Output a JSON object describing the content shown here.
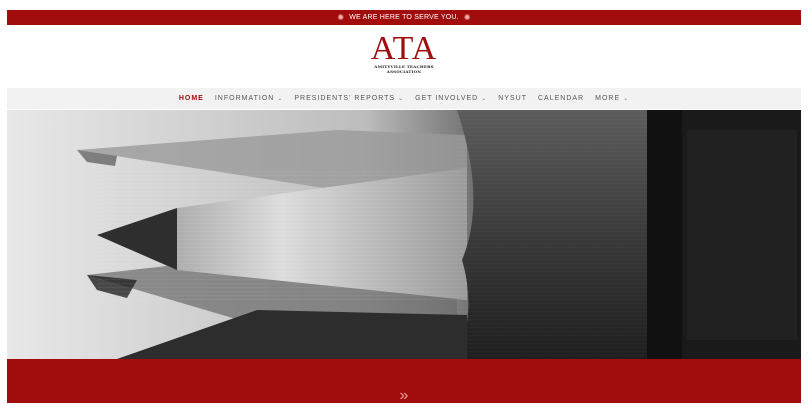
{
  "announcement": {
    "text": "WE ARE HERE TO SERVE YOU.",
    "icon": "star-icon"
  },
  "logo": {
    "mark": "ATA",
    "line1": "AMITYVILLE TEACHERS",
    "line2": "ASSOCIATION"
  },
  "nav": {
    "items": [
      {
        "label": "HOME",
        "active": true,
        "dropdown": false
      },
      {
        "label": "INFORMATION",
        "dropdown": true
      },
      {
        "label": "PRESIDENTS' REPORTS",
        "dropdown": true
      },
      {
        "label": "GET INVOLVED",
        "dropdown": true
      },
      {
        "label": "NYSUT",
        "dropdown": false
      },
      {
        "label": "CALENDAR",
        "dropdown": false
      },
      {
        "label": "MORE",
        "dropdown": true
      }
    ]
  },
  "hero": {
    "subject": "close-up of sharpened pencils",
    "tone": "grayscale"
  },
  "scroll_cue": {
    "glyph": "»",
    "icon": "double-chevron-right-icon"
  },
  "colors": {
    "brand": "#a10d0d",
    "nav_bg": "#f2f2f2"
  }
}
